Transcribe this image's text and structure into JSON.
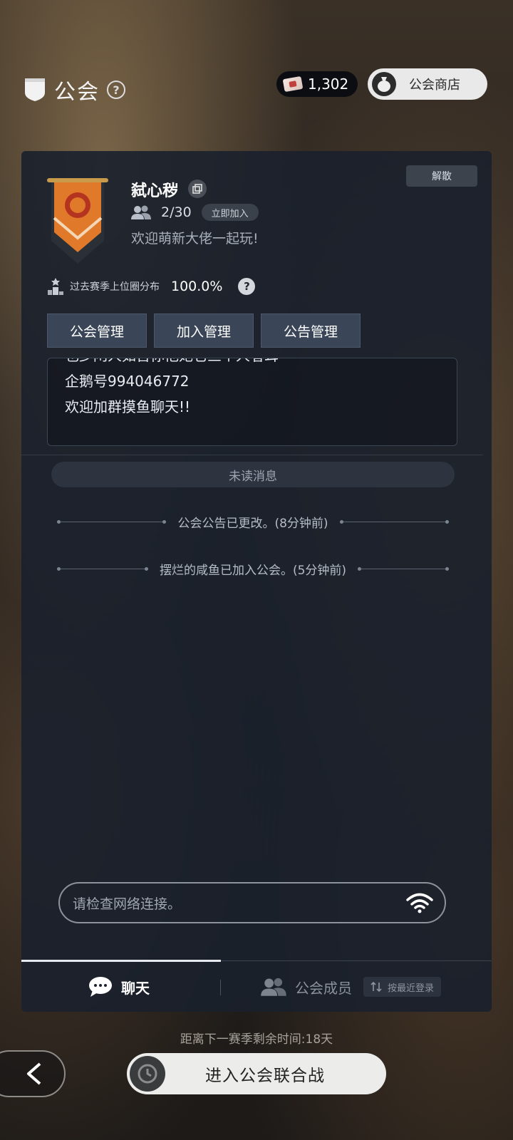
{
  "header": {
    "title": "公会",
    "help_symbol": "?",
    "currency_value": "1,302",
    "shop_label": "公会商店"
  },
  "guild": {
    "name": "弑心秽",
    "members": "2/30",
    "join_badge": "立即加入",
    "motto": "欢迎萌新大佬一起玩!",
    "disband_label": "解散",
    "rank_label": "过去赛季上位圈分布",
    "rank_value": "100.0%",
    "rank_help": "?",
    "banner_color": "#e07a2a"
  },
  "management": {
    "buttons": [
      "公会管理",
      "加入管理",
      "公告管理"
    ]
  },
  "notice": {
    "lines": [
      "也少闲人如吾你他她它三个人者耳",
      "企鹅号994046772",
      "欢迎加群摸鱼聊天!!"
    ]
  },
  "chat": {
    "unread_label": "未读消息",
    "system_messages": [
      "公会公告已更改。(8分钟前)",
      "摆烂的咸鱼已加入公会。(5分钟前)"
    ],
    "input_placeholder": "请检查网络连接。"
  },
  "tabs": {
    "chat": "聊天",
    "members": "公会成员",
    "sort": "按最近登录",
    "sort_icon": "sort-arrows-icon"
  },
  "footer": {
    "season_text": "距离下一赛季剩余时间:18天",
    "battle_label": "进入公会联合战"
  }
}
